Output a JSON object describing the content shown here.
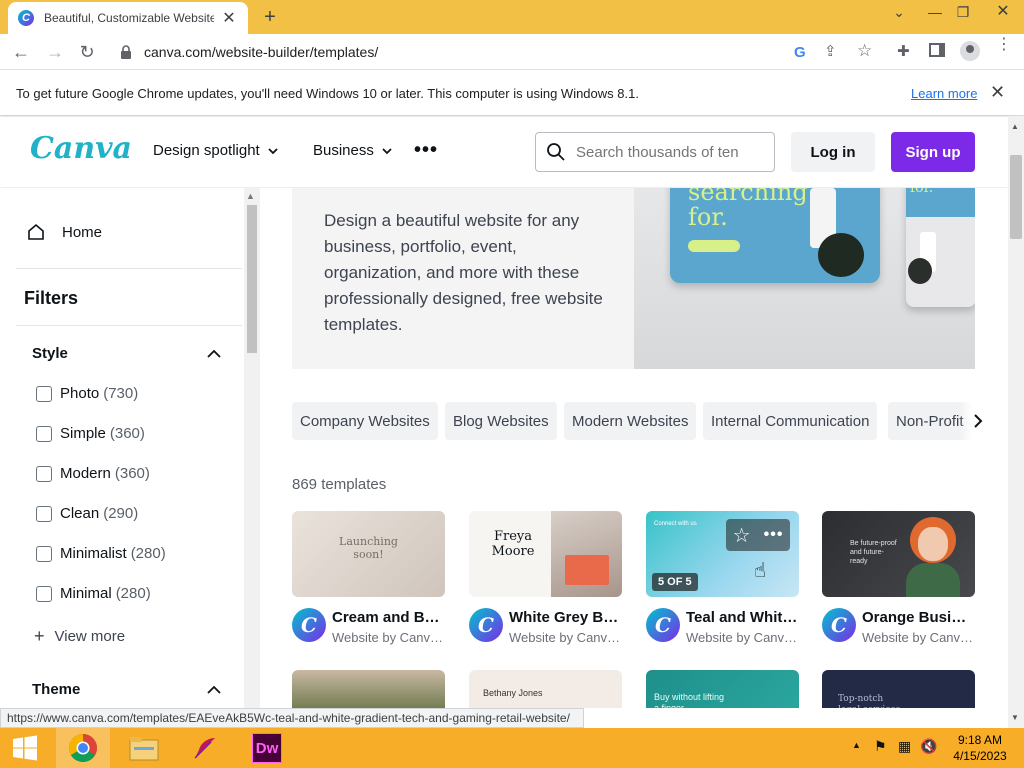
{
  "browser": {
    "tab_title": "Beautiful, Customizable Website",
    "url": "canva.com/website-builder/templates/",
    "info_message": "To get future Google Chrome updates, you'll need Windows 10 or later. This computer is using Windows 8.1.",
    "learn_more": "Learn more",
    "status_url": "https://www.canva.com/templates/EAEveAkB5Wc-teal-and-white-gradient-tech-and-gaming-retail-website/"
  },
  "header": {
    "logo": "Canva",
    "nav": [
      "Design spotlight",
      "Business"
    ],
    "search_placeholder": "Search thousands of ten",
    "login": "Log in",
    "signup": "Sign up"
  },
  "sidebar": {
    "home": "Home",
    "filters": "Filters",
    "style_title": "Style",
    "style_options": [
      {
        "label": "Photo",
        "count": "(730)"
      },
      {
        "label": "Simple",
        "count": "(360)"
      },
      {
        "label": "Modern",
        "count": "(360)"
      },
      {
        "label": "Clean",
        "count": "(290)"
      },
      {
        "label": "Minimalist",
        "count": "(280)"
      },
      {
        "label": "Minimal",
        "count": "(280)"
      }
    ],
    "view_more": "View more",
    "theme_title": "Theme"
  },
  "hero": {
    "text": "Design a beautiful website for any business, portfolio, event, organization, and more with these professionally designed, free website templates.",
    "image_text": "searching for.",
    "image_text2": "for."
  },
  "chips": [
    "Company Websites",
    "Blog Websites",
    "Modern Websites",
    "Internal Communication",
    "Non-Profit"
  ],
  "count": "869 templates",
  "templates": [
    {
      "title": "Cream and Bro…",
      "subtitle": "Website by Canv…",
      "thumb_text": "Launching soon!"
    },
    {
      "title": "White Grey Bla…",
      "subtitle": "Website by Canv…",
      "thumb_text": "Freya Moore"
    },
    {
      "title": "Teal and White…",
      "subtitle": "Website by Canv…",
      "thumb_text": "Connect with us",
      "badge": "5 OF 5"
    },
    {
      "title": "Orange Busine…",
      "subtitle": "Website by Canv…",
      "thumb_text": "Be future-proof and future-ready"
    }
  ],
  "row2": [
    {
      "thumb_text": ""
    },
    {
      "thumb_text": "Bethany Jones"
    },
    {
      "thumb_text": "Buy without lifting a finger."
    },
    {
      "thumb_text": "Top-notch legal services"
    }
  ],
  "taskbar": {
    "time": "9:18 AM",
    "date": "4/15/2023",
    "dw_label": "Dw"
  }
}
